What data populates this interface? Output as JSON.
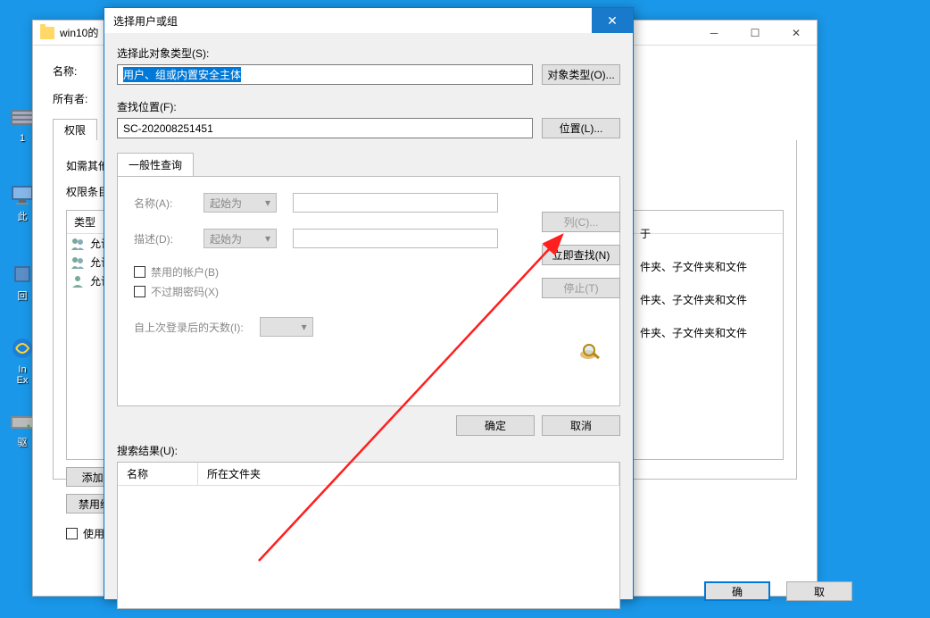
{
  "bg_window": {
    "title_prefix": "win10的",
    "name_label": "名称:",
    "owner_label": "所有者:",
    "tab_permissions": "权限",
    "other_text": "如需其他信",
    "entries_label": "权限条目:",
    "col_type": "类型",
    "rows": [
      "允许",
      "允许",
      "允许"
    ],
    "add_btn": "添加(D)",
    "deny_btn": "禁用继承",
    "use_check": "使用可从",
    "applies_header": "于",
    "applies1": "件夹、子文件夹和文件",
    "applies2": "件夹、子文件夹和文件",
    "applies3": "件夹、子文件夹和文件",
    "ok": "确",
    "cancel": "取"
  },
  "dialog": {
    "title": "选择用户或组",
    "obj_type_label": "选择此对象类型(S):",
    "obj_type_value": "用户、组或内置安全主体",
    "obj_type_btn": "对象类型(O)...",
    "location_label": "查找位置(F):",
    "location_value": "SC-202008251451",
    "location_btn": "位置(L)...",
    "tab_common": "一般性查询",
    "name_label": "名称(A):",
    "desc_label": "描述(D):",
    "starts_with": "起始为",
    "disabled_check": "禁用的帐户(B)",
    "pwd_check": "不过期密码(X)",
    "days_label": "自上次登录后的天数(I):",
    "columns_btn": "列(C)...",
    "find_btn": "立即查找(N)",
    "stop_btn": "停止(T)",
    "ok": "确定",
    "cancel": "取消",
    "results_label": "搜索结果(U):",
    "col_name": "名称",
    "col_folder": "所在文件夹"
  }
}
